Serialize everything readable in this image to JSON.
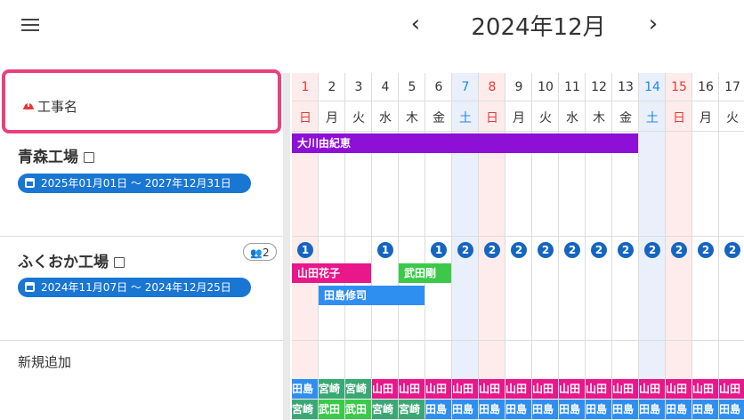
{
  "header": {
    "month_label": "2024年12月",
    "prev": "‹",
    "next": "›"
  },
  "left_header": {
    "label": "工事名"
  },
  "days": [
    {
      "d": "1",
      "w": "日",
      "type": "sun"
    },
    {
      "d": "2",
      "w": "月",
      "type": "wk"
    },
    {
      "d": "3",
      "w": "火",
      "type": "wk"
    },
    {
      "d": "4",
      "w": "水",
      "type": "wk"
    },
    {
      "d": "5",
      "w": "木",
      "type": "wk"
    },
    {
      "d": "6",
      "w": "金",
      "type": "wk"
    },
    {
      "d": "7",
      "w": "土",
      "type": "sat"
    },
    {
      "d": "8",
      "w": "日",
      "type": "sun"
    },
    {
      "d": "9",
      "w": "月",
      "type": "wk"
    },
    {
      "d": "10",
      "w": "火",
      "type": "wk"
    },
    {
      "d": "11",
      "w": "水",
      "type": "wk"
    },
    {
      "d": "12",
      "w": "木",
      "type": "wk"
    },
    {
      "d": "13",
      "w": "金",
      "type": "wk"
    },
    {
      "d": "14",
      "w": "土",
      "type": "sat"
    },
    {
      "d": "15",
      "w": "日",
      "type": "sun"
    },
    {
      "d": "16",
      "w": "月",
      "type": "wk"
    },
    {
      "d": "17",
      "w": "火",
      "type": "wk"
    }
  ],
  "projects": [
    {
      "name": "青森工場",
      "period": "2025年01月01日 〜 2027年12月31日"
    },
    {
      "name": "ふくおか工場",
      "period": "2024年11月07日 〜 2024年12月25日",
      "member_count": "2"
    }
  ],
  "new_row": {
    "label": "新規追加"
  },
  "bars": [
    {
      "label": "大川由紀恵",
      "color": "#8e0fd6"
    },
    {
      "label": "山田花子",
      "color": "#e8178a"
    },
    {
      "label": "武田剛",
      "color": "#3cc94a"
    },
    {
      "label": "田島修司",
      "color": "#2f8ff0"
    }
  ],
  "counts": [
    "1",
    "",
    "",
    "1",
    "",
    "1",
    "2",
    "2",
    "2",
    "2",
    "2",
    "2",
    "2",
    "2",
    "2",
    "2",
    "2"
  ],
  "chips_row1": [
    {
      "t": "田島",
      "c": "#2f8ff0"
    },
    {
      "t": "宮崎",
      "c": "#3aa875"
    },
    {
      "t": "宮崎",
      "c": "#3aa875"
    },
    {
      "t": "山田",
      "c": "#e8178a"
    },
    {
      "t": "山田",
      "c": "#e8178a"
    },
    {
      "t": "山田",
      "c": "#e8178a"
    },
    {
      "t": "山田",
      "c": "#e8178a"
    },
    {
      "t": "山田",
      "c": "#e8178a"
    },
    {
      "t": "山田",
      "c": "#e8178a"
    },
    {
      "t": "山田",
      "c": "#e8178a"
    },
    {
      "t": "山田",
      "c": "#e8178a"
    },
    {
      "t": "山田",
      "c": "#e8178a"
    },
    {
      "t": "山田",
      "c": "#e8178a"
    },
    {
      "t": "山田",
      "c": "#e8178a"
    },
    {
      "t": "山田",
      "c": "#e8178a"
    },
    {
      "t": "山田",
      "c": "#e8178a"
    },
    {
      "t": "山田",
      "c": "#e8178a"
    }
  ],
  "chips_row2": [
    {
      "t": "宮崎",
      "c": "#3aa875"
    },
    {
      "t": "武田",
      "c": "#3cc94a"
    },
    {
      "t": "武田",
      "c": "#3cc94a"
    },
    {
      "t": "宮崎",
      "c": "#3aa875"
    },
    {
      "t": "宮崎",
      "c": "#3aa875"
    },
    {
      "t": "田島",
      "c": "#2f8ff0"
    },
    {
      "t": "田島",
      "c": "#2f8ff0"
    },
    {
      "t": "田島",
      "c": "#2f8ff0"
    },
    {
      "t": "田島",
      "c": "#2f8ff0"
    },
    {
      "t": "田島",
      "c": "#2f8ff0"
    },
    {
      "t": "田島",
      "c": "#2f8ff0"
    },
    {
      "t": "田島",
      "c": "#2f8ff0"
    },
    {
      "t": "田島",
      "c": "#2f8ff0"
    },
    {
      "t": "田島",
      "c": "#2f8ff0"
    },
    {
      "t": "田島",
      "c": "#2f8ff0"
    },
    {
      "t": "田島",
      "c": "#2f8ff0"
    },
    {
      "t": "田島",
      "c": "#2f8ff0"
    }
  ],
  "colors": {
    "sunday_bg": "#fdeceb",
    "saturday_bg": "#e9effb",
    "sunday_text": "#e53935",
    "saturday_text": "#1e88e5",
    "pill": "#1976d2",
    "highlight": "#ec407a"
  }
}
